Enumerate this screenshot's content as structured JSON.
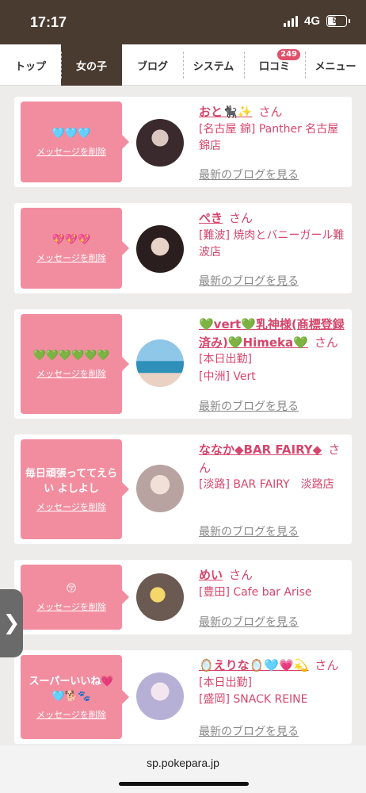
{
  "status_bar": {
    "time": "17:17",
    "network": "4G",
    "battery": "52"
  },
  "nav": {
    "tabs": [
      {
        "label": "トップ",
        "active": false
      },
      {
        "label": "女の子",
        "active": true
      },
      {
        "label": "ブログ",
        "active": false
      },
      {
        "label": "システム",
        "active": false
      },
      {
        "label": "口コミ",
        "active": false,
        "badge": "249"
      },
      {
        "label": "メニュー",
        "active": false
      }
    ]
  },
  "common": {
    "san": "さん",
    "delete_label": "メッセージを削除",
    "blog_link": "最新のブログを見る"
  },
  "cards": [
    {
      "message": "🩵🩵🩵",
      "name": "おと🐈‍⬛✨",
      "shop_lines": [
        "[名古屋 錦] Panther 名古屋錦店"
      ]
    },
    {
      "message": "💖💖💖",
      "name": "ぺき",
      "shop_lines": [
        "[難波] 焼肉とバニーガール難波店"
      ]
    },
    {
      "message": "💚💚💚💚💚💚",
      "name": "💚vert💚乳神様(商標登録済み)💚Himeka💚",
      "shop_lines": [
        "[本日出勤]",
        "[中洲] Vert"
      ]
    },
    {
      "message": "毎日頑張っててえらい よしよし",
      "name": "ななか◆BAR FAIRY◆",
      "shop_lines": [
        "[淡路] BAR FAIRY　淡路店"
      ]
    },
    {
      "message": "😚",
      "name": "めい",
      "shop_lines": [
        "[豊田] Cafe bar Arise"
      ]
    },
    {
      "message": "スーパーいいね💗🩵🐕🐾",
      "name": "🪞えりな🪞🩵💗💫",
      "shop_lines": [
        "[本日出勤]",
        "[盛岡] SNACK REINE"
      ]
    }
  ],
  "side_handle": {
    "glyph": "❯"
  },
  "url_bar": {
    "url": "sp.pokepara.jp"
  }
}
